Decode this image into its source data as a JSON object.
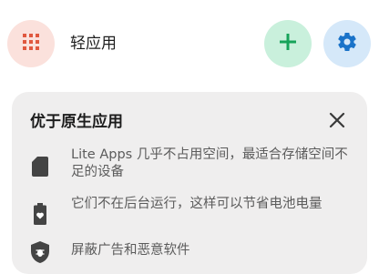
{
  "app_bar": {
    "title": "轻应用",
    "menu_icon": "grid-icon",
    "add_icon": "plus-icon",
    "settings_icon": "gear-icon",
    "colors": {
      "menu_bg": "#fbe1dc",
      "menu_fg": "#e0583f",
      "add_bg": "#c9f0dc",
      "add_fg": "#16a35a",
      "settings_bg": "#d5e8f9",
      "settings_fg": "#1a73c9"
    }
  },
  "card": {
    "title": "优于原生应用",
    "close_icon": "close-icon",
    "features": [
      {
        "icon": "sd-card-icon",
        "text": "Lite Apps 几乎不占用空间，最适合存储空间不足的设备"
      },
      {
        "icon": "battery-icon",
        "text": "它们不在后台运行，这样可以节省电池电量"
      },
      {
        "icon": "shield-bug-icon",
        "text": "屏蔽广告和恶意软件"
      }
    ]
  }
}
